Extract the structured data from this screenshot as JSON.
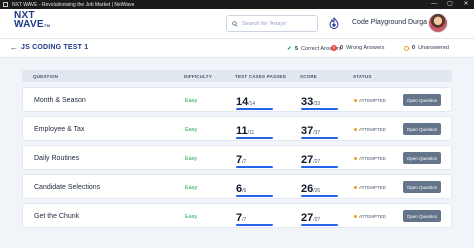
{
  "window": {
    "title": "NXT WAVE - Revolutionising the Job Market | NxtWave",
    "controls": [
      "—",
      "▢",
      "✕"
    ]
  },
  "navbar": {
    "logo_line1": "NXT",
    "logo_line2": "WAVE",
    "logo_tm": "TM",
    "search_placeholder": "Search for 'Arrays'",
    "code_playground": "Code Playground",
    "user_name": "Durga"
  },
  "test_header": {
    "back_icon": "back-arrow-icon",
    "title": "JS CODING TEST 1",
    "correct_count": "5",
    "correct_label": "Correct Answers",
    "wrong_count": "0",
    "wrong_label": "Wrong Answers",
    "unanswered_count": "0",
    "unanswered_label": "Unanswered"
  },
  "table": {
    "columns": [
      "QUESTION",
      "DIFFICULTY",
      "TEST CASES PASSED",
      "SCORE",
      "STATUS"
    ],
    "rows": [
      {
        "question": "Month & Season",
        "difficulty": "Easy",
        "tc_passed": "14",
        "tc_total": "/14",
        "tc_progress": 1.0,
        "score": "33",
        "score_total": "/33",
        "score_progress": 1.0,
        "status": "ATTEMPTED",
        "button": "Open Question"
      },
      {
        "question": "Employee & Tax",
        "difficulty": "Easy",
        "tc_passed": "11",
        "tc_total": "/11",
        "tc_progress": 1.0,
        "score": "37",
        "score_total": "/37",
        "score_progress": 1.0,
        "status": "ATTEMPTED",
        "button": "Open Question"
      },
      {
        "question": "Daily Routines",
        "difficulty": "Easy",
        "tc_passed": "7",
        "tc_total": "/7",
        "tc_progress": 1.0,
        "score": "27",
        "score_total": "/27",
        "score_progress": 1.0,
        "status": "ATTEMPTED",
        "button": "Open Question"
      },
      {
        "question": "Candidate Selections",
        "difficulty": "Easy",
        "tc_passed": "6",
        "tc_total": "/6",
        "tc_progress": 1.0,
        "score": "26",
        "score_total": "/26",
        "score_progress": 1.0,
        "status": "ATTEMPTED",
        "button": "Open Question"
      },
      {
        "question": "Get the Chunk",
        "difficulty": "Easy",
        "tc_passed": "7",
        "tc_total": "/7",
        "tc_progress": 1.0,
        "score": "27",
        "score_total": "/27",
        "score_progress": 1.0,
        "status": "ATTEMPTED",
        "button": "Open Question"
      }
    ]
  },
  "colors": {
    "brand": "#1e3a8a",
    "easy": "#16a34a",
    "progress": "#2563eb",
    "attempted": "#f59e0b",
    "button": "#64748b"
  }
}
